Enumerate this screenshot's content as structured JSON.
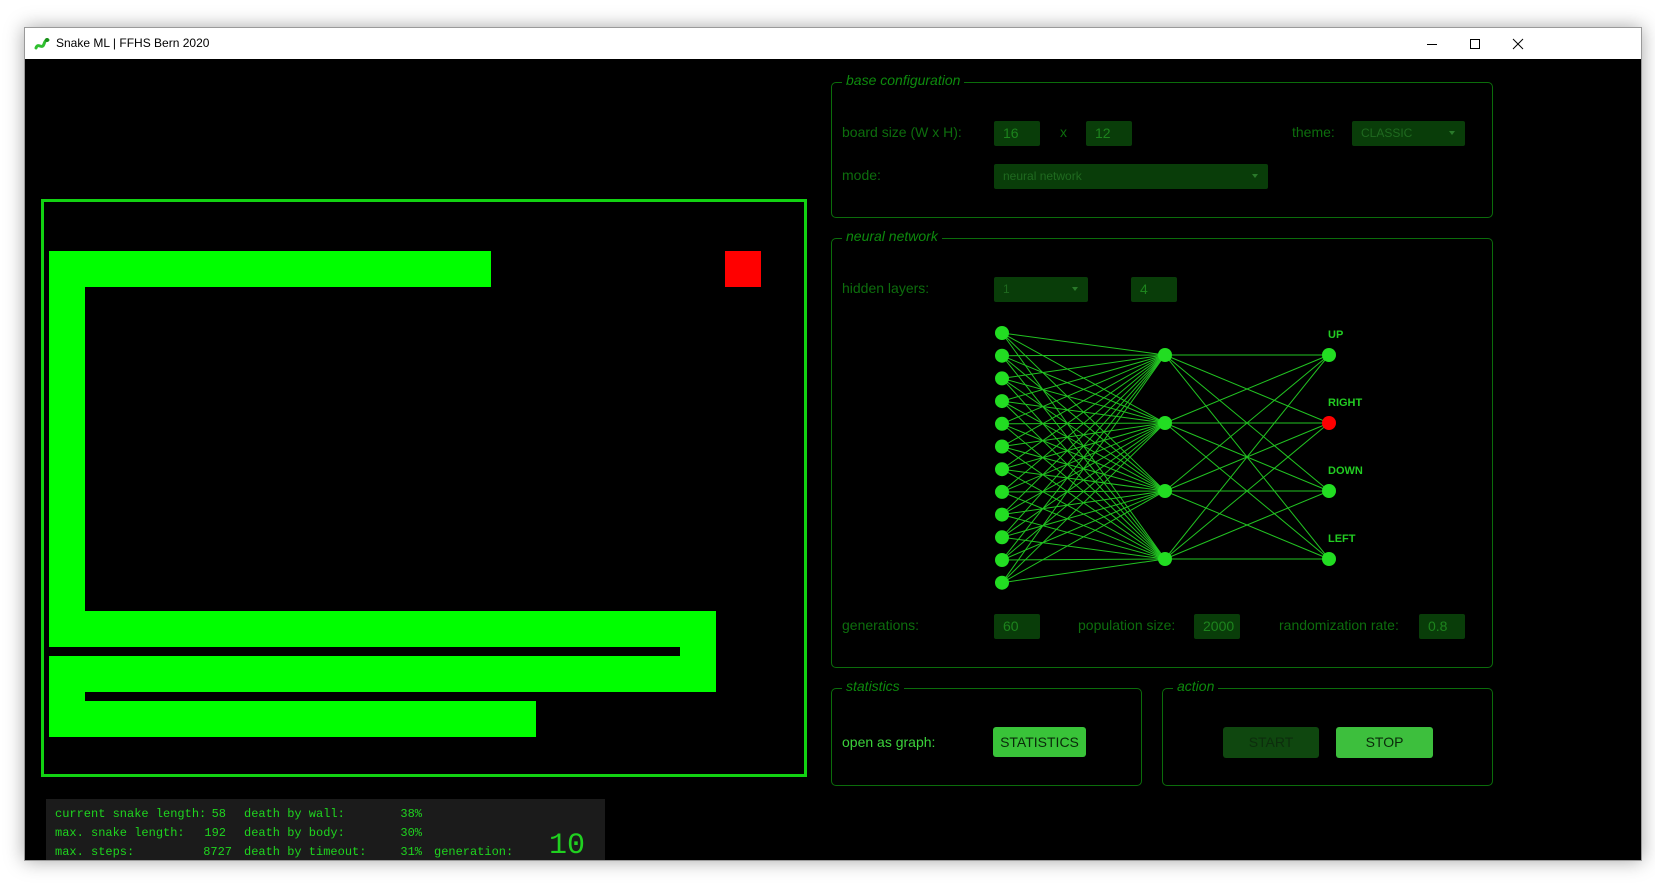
{
  "window": {
    "title": "Snake ML | FFHS Bern 2020"
  },
  "board_stats": {
    "labels": [
      "current snake length:",
      "max. snake length:",
      "max. steps:"
    ],
    "values": [
      "58",
      "192",
      "8727"
    ],
    "death_labels": [
      "death by wall:",
      "death by body:",
      "death by timeout:"
    ],
    "death_values": [
      "38%",
      "30%",
      "31%"
    ],
    "generation_label": "generation:",
    "generation_value": "10"
  },
  "base_config": {
    "legend": "base configuration",
    "board_size_label": "board size (W x H):",
    "board_width": "16",
    "times": "x",
    "board_height": "12",
    "theme_label": "theme:",
    "theme_value": "CLASSIC",
    "mode_label": "mode:",
    "mode_value": "neural network"
  },
  "neural_network": {
    "legend": "neural network",
    "hidden_layers_label": "hidden layers:",
    "hidden_layers_value": "1",
    "neurons_value": "4",
    "input_count": 12,
    "hidden_count": 4,
    "outputs": [
      "UP",
      "RIGHT",
      "DOWN",
      "LEFT"
    ],
    "active_output": "RIGHT",
    "generations_label": "generations:",
    "generations_value": "60",
    "population_label": "population size:",
    "population_value": "2000",
    "randomization_label": "randomization rate:",
    "randomization_value": "0.8"
  },
  "statistics": {
    "legend": "statistics",
    "open_label": "open as graph:",
    "button_label": "STATISTICS"
  },
  "action": {
    "legend": "action",
    "start_label": "START",
    "stop_label": "STOP"
  },
  "colors": {
    "snake": "#00ff00",
    "food": "#ff0000",
    "background": "#000000",
    "accent": "#39c339"
  }
}
